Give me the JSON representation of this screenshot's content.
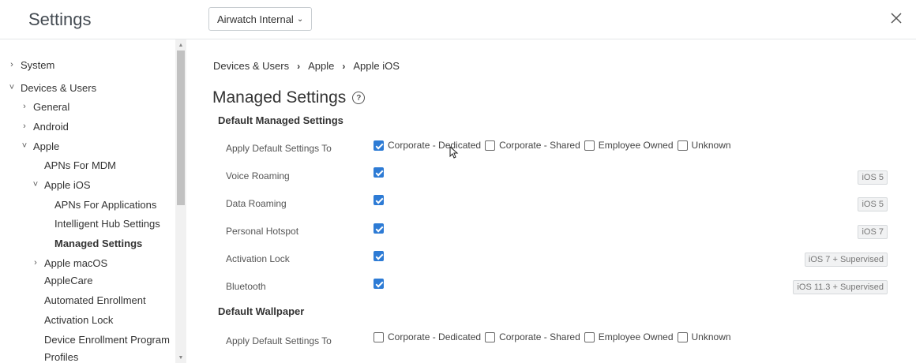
{
  "header": {
    "title": "Settings",
    "org_select": "Airwatch Internal",
    "close_icon": "close-icon"
  },
  "sidebar": {
    "items": [
      {
        "label": "System",
        "caret": "›"
      },
      {
        "label": "Devices & Users",
        "caret": "˅"
      },
      {
        "label": "General",
        "caret": "›"
      },
      {
        "label": "Android",
        "caret": "›"
      },
      {
        "label": "Apple",
        "caret": "˅"
      },
      {
        "label": "APNs For MDM",
        "caret": ""
      },
      {
        "label": "Apple iOS",
        "caret": "˅"
      },
      {
        "label": "APNs For Applications",
        "caret": ""
      },
      {
        "label": "Intelligent Hub Settings",
        "caret": ""
      },
      {
        "label": "Managed Settings",
        "caret": ""
      },
      {
        "label": "Apple macOS",
        "caret": "›"
      },
      {
        "label": "AppleCare",
        "caret": ""
      },
      {
        "label": "Automated Enrollment",
        "caret": ""
      },
      {
        "label": "Activation Lock",
        "caret": ""
      },
      {
        "label": "Device Enrollment Program",
        "caret": ""
      },
      {
        "label": "Profiles",
        "caret": ""
      }
    ]
  },
  "breadcrumb": [
    "Devices & Users",
    "Apple",
    "Apple iOS"
  ],
  "page_title": "Managed Settings",
  "sections": {
    "managed": {
      "title": "Default Managed Settings",
      "apply_label": "Apply Default Settings To",
      "apply_options": [
        {
          "label": "Corporate - Dedicated",
          "checked": true
        },
        {
          "label": "Corporate - Shared",
          "checked": false
        },
        {
          "label": "Employee Owned",
          "checked": false
        },
        {
          "label": "Unknown",
          "checked": false
        }
      ],
      "settings": [
        {
          "label": "Voice Roaming",
          "checked": true,
          "badge": "iOS 5"
        },
        {
          "label": "Data Roaming",
          "checked": true,
          "badge": "iOS 5"
        },
        {
          "label": "Personal Hotspot",
          "checked": true,
          "badge": "iOS 7"
        },
        {
          "label": "Activation Lock",
          "checked": true,
          "badge": "iOS 7 + Supervised"
        },
        {
          "label": "Bluetooth",
          "checked": true,
          "badge": "iOS 11.3 + Supervised"
        }
      ]
    },
    "wallpaper": {
      "title": "Default Wallpaper",
      "apply_label": "Apply Default Settings To",
      "apply_options": [
        {
          "label": "Corporate - Dedicated",
          "checked": false
        },
        {
          "label": "Corporate - Shared",
          "checked": false
        },
        {
          "label": "Employee Owned",
          "checked": false
        },
        {
          "label": "Unknown",
          "checked": false
        }
      ]
    }
  },
  "colors": {
    "checkbox_checked": "#2d7bd5",
    "badge_bg": "#f1f2f3"
  }
}
